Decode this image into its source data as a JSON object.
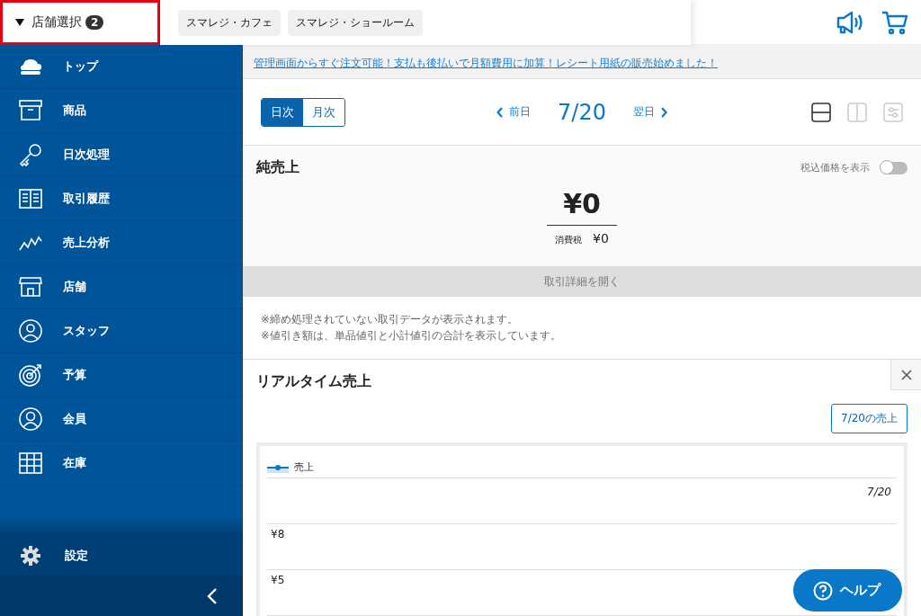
{
  "header": {
    "store_select": {
      "label": "店舗選択",
      "count": "2",
      "highlighted": true
    },
    "stores": [
      {
        "label": "スマレジ・カフェ"
      },
      {
        "label": "スマレジ・ショールーム"
      }
    ]
  },
  "sidebar": {
    "items": [
      {
        "label": "トップ"
      },
      {
        "label": "商品"
      },
      {
        "label": "日次処理"
      },
      {
        "label": "取引履歴"
      },
      {
        "label": "売上分析"
      },
      {
        "label": "店舗"
      },
      {
        "label": "スタッフ"
      },
      {
        "label": "予算"
      },
      {
        "label": "会員"
      },
      {
        "label": "在庫"
      }
    ],
    "settings": {
      "label": "設定"
    }
  },
  "banner": {
    "link": "管理画面からすぐ注文可能！支払も後払いで月額費用に加算！レシート用紙の販売始めました！"
  },
  "toolbar": {
    "period_tabs": [
      {
        "label": "日次",
        "selected": true
      },
      {
        "label": "月次",
        "selected": false
      }
    ],
    "prev": "前日",
    "date": "7/20",
    "next": "翌日",
    "view_modes": [
      {
        "selected": true
      },
      {
        "selected": false
      }
    ]
  },
  "net_sales": {
    "title": "純売上",
    "tax_toggle": {
      "label": "税込価格を表示",
      "on": false
    },
    "amount": "¥0",
    "tax_label": "消費税",
    "tax_amount": "¥0",
    "details_button": "取引詳細を開く",
    "notes": [
      "※締め処理されていない取引データが表示されます。",
      "※値引き額は、単品値引と小計値引の合計を表示しています。"
    ]
  },
  "realtime": {
    "title": "リアルタイム売上",
    "date_button": "7/20の売上",
    "legend": "売上",
    "date_label": "7/20",
    "y_labels": [
      "¥8",
      "¥5"
    ]
  },
  "help_button": "ヘルプ"
}
